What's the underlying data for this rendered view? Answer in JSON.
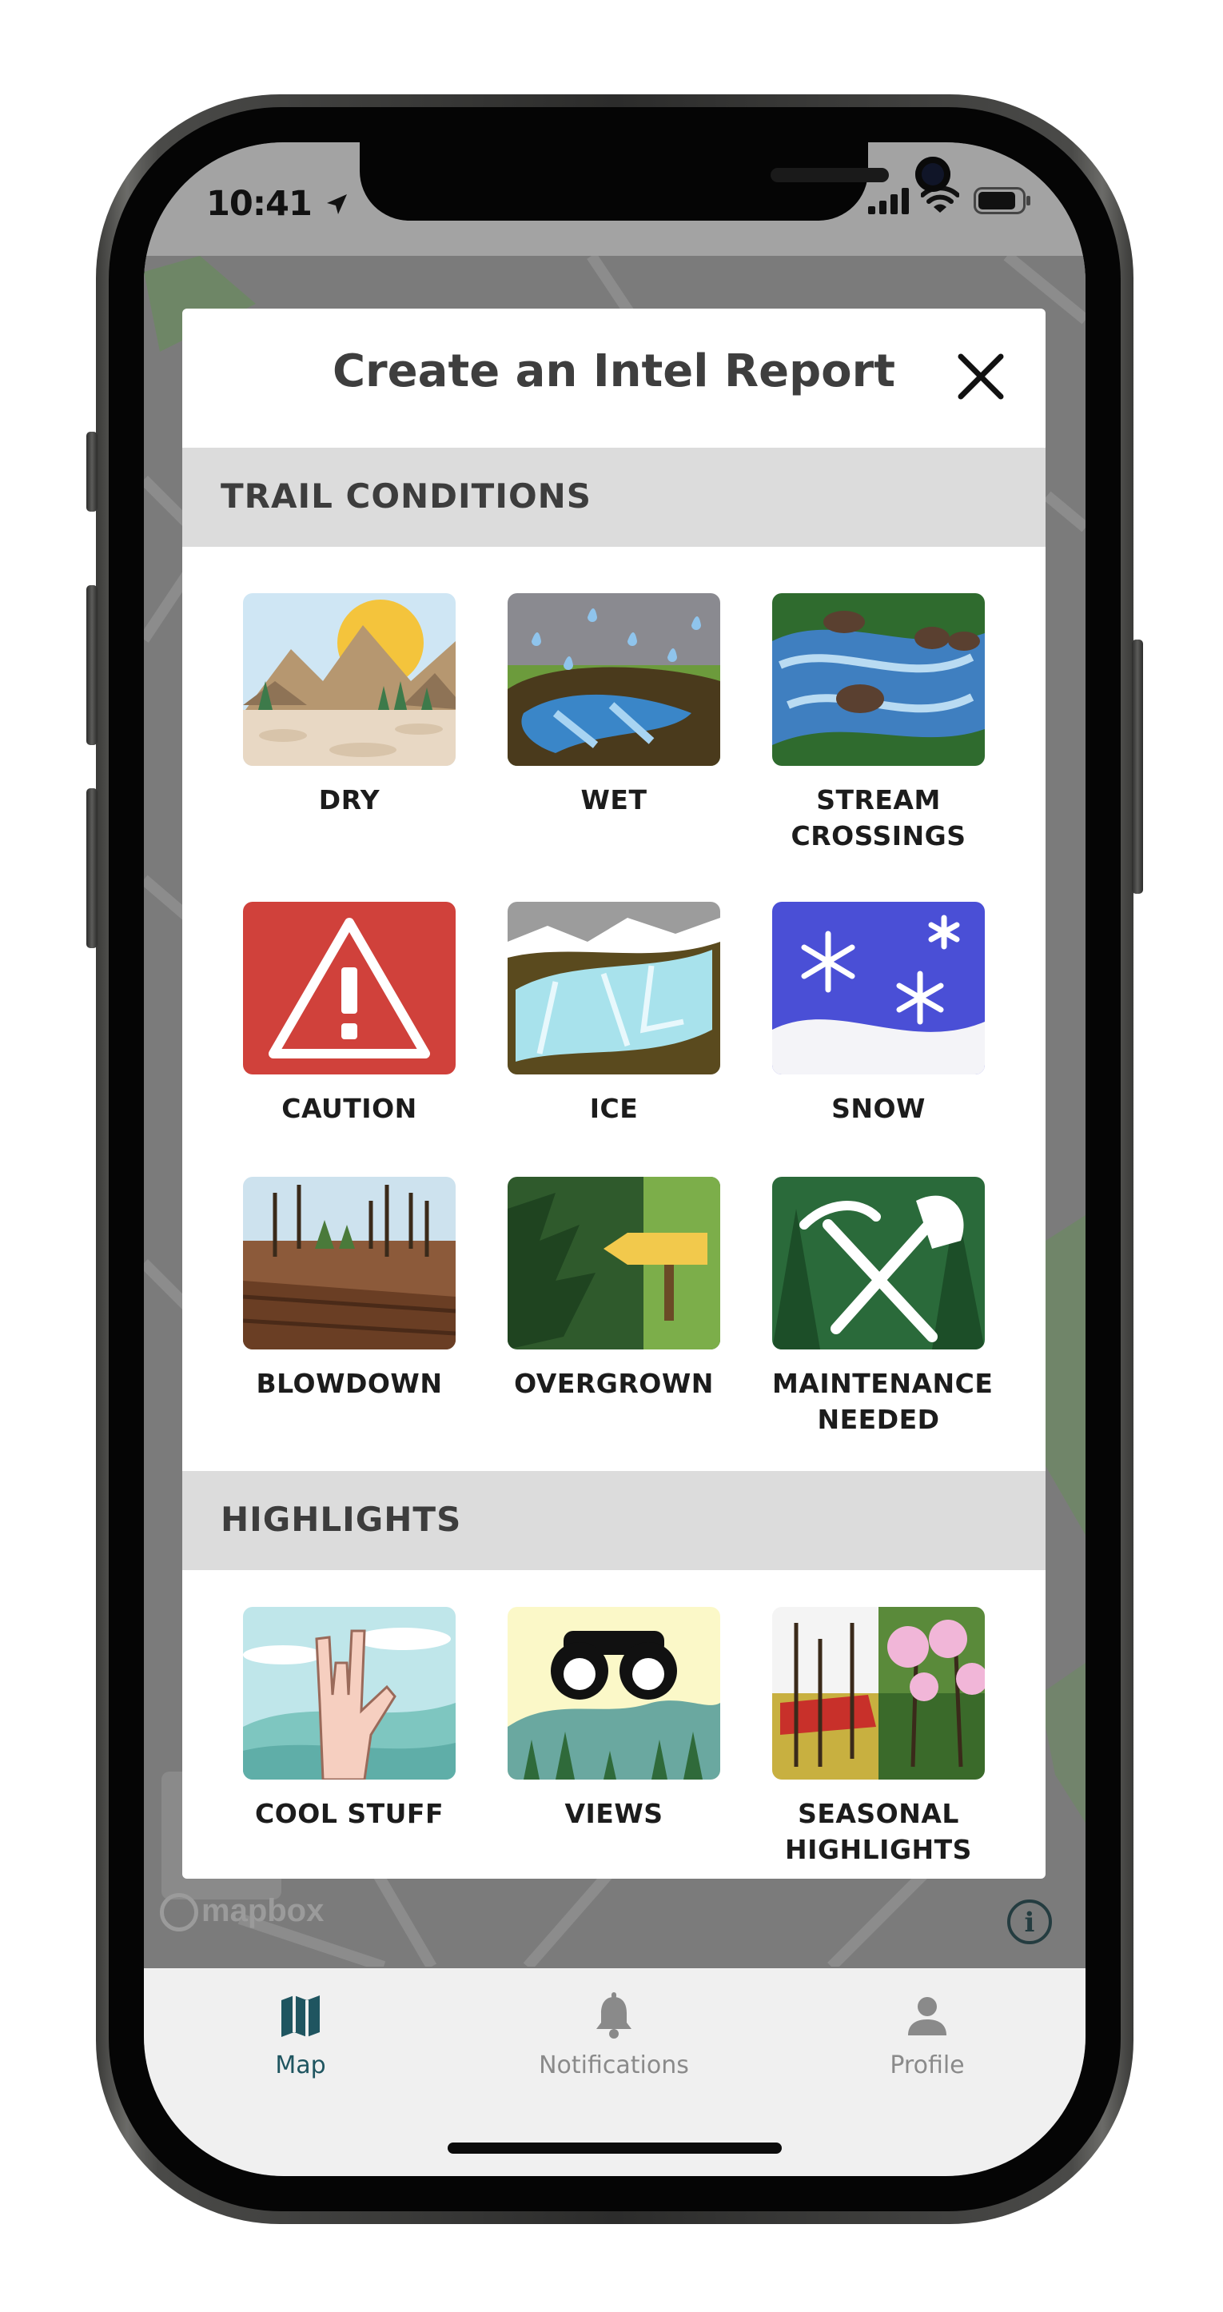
{
  "status_bar": {
    "time": "10:41"
  },
  "modal": {
    "title": "Create an Intel Report",
    "sections": [
      {
        "title": "TRAIL CONDITIONS",
        "items": [
          {
            "line1": "DRY",
            "line2": ""
          },
          {
            "line1": "WET",
            "line2": ""
          },
          {
            "line1": "STREAM",
            "line2": "CROSSINGS"
          },
          {
            "line1": "CAUTION",
            "line2": ""
          },
          {
            "line1": "ICE",
            "line2": ""
          },
          {
            "line1": "SNOW",
            "line2": ""
          },
          {
            "line1": "BLOWDOWN",
            "line2": ""
          },
          {
            "line1": "OVERGROWN",
            "line2": ""
          },
          {
            "line1": "MAINTENANCE",
            "line2": "NEEDED"
          }
        ]
      },
      {
        "title": "HIGHLIGHTS",
        "items": [
          {
            "line1": "COOL STUFF",
            "line2": ""
          },
          {
            "line1": "VIEWS",
            "line2": ""
          },
          {
            "line1": "SEASONAL",
            "line2": "HIGHLIGHTS"
          }
        ]
      }
    ]
  },
  "map": {
    "attribution_logo": "mapbox",
    "info_glyph": "i"
  },
  "tab_bar": {
    "tabs": [
      {
        "label": "Map",
        "icon": "map-icon",
        "active": true
      },
      {
        "label": "Notifications",
        "icon": "bell-icon",
        "active": false
      },
      {
        "label": "Profile",
        "icon": "person-icon",
        "active": false
      }
    ]
  },
  "colors": {
    "accent": "#1f5560",
    "inactive": "#8a8a8a",
    "section_bg": "#dcdcdc",
    "caution_red": "#d0413b",
    "snow_blue": "#4a4fd6"
  }
}
